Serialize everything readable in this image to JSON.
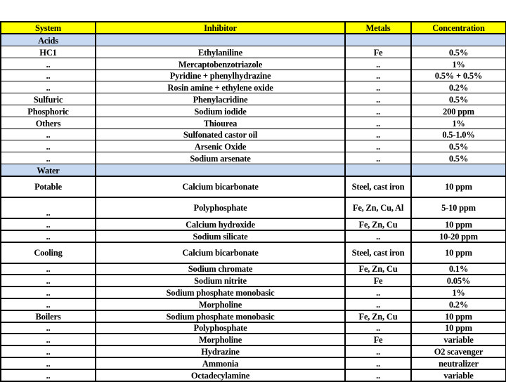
{
  "table": {
    "headers": {
      "system": "System",
      "inhibitor": "Inhibitor",
      "metals": "Metals",
      "concentration": "Concentration"
    },
    "sections": [
      {
        "label": "Acids",
        "rows": [
          {
            "system": "HC1",
            "inhibitor": "Ethylaniline",
            "metals": "Fe",
            "concentration": "0.5%"
          },
          {
            "system": "..",
            "inhibitor": "Mercaptobenzotriazole",
            "metals": "..",
            "concentration": "1%"
          },
          {
            "system": "..",
            "inhibitor": "Pyridine + phenylhydrazine",
            "metals": "..",
            "concentration": "0.5% + 0.5%"
          },
          {
            "system": "..",
            "inhibitor": "Rosin amine + ethylene oxide",
            "metals": "..",
            "concentration": "0.2%"
          },
          {
            "system": "Sulfuric",
            "inhibitor": "Phenylacridine",
            "metals": "..",
            "concentration": "0.5%"
          },
          {
            "system": "Phosphoric",
            "inhibitor": "Sodium iodide",
            "metals": "..",
            "concentration": "200 ppm"
          },
          {
            "system": "Others",
            "inhibitor": "Thiourea",
            "metals": "..",
            "concentration": "1%"
          },
          {
            "system": "..",
            "inhibitor": "Sulfonated castor oil",
            "metals": "..",
            "concentration": "0.5-1.0%"
          },
          {
            "system": "..",
            "inhibitor": "Arsenic Oxide",
            "metals": "..",
            "concentration": "0.5%"
          },
          {
            "system": "..",
            "inhibitor": "Sodium arsenate",
            "metals": "..",
            "concentration": "0.5%"
          }
        ]
      },
      {
        "label": "Water",
        "rows": [
          {
            "system": "Potable",
            "inhibitor": "Calcium bicarbonate",
            "metals": "Steel, cast iron",
            "concentration": "10 ppm"
          },
          {
            "system": "..",
            "inhibitor": "Polyphosphate",
            "metals": "Fe, Zn, Cu, Al",
            "concentration": "5-10 ppm"
          },
          {
            "system": "..",
            "inhibitor": "Calcium hydroxide",
            "metals": "Fe, Zn, Cu",
            "concentration": "10 ppm"
          },
          {
            "system": "..",
            "inhibitor": "Sodium silicate",
            "metals": "..",
            "concentration": "10-20 ppm"
          },
          {
            "system": "Cooling",
            "inhibitor": "Calcium bicarbonate",
            "metals": "Steel, cast iron",
            "concentration": "10 ppm"
          },
          {
            "system": "..",
            "inhibitor": "Sodium chromate",
            "metals": "Fe, Zn, Cu",
            "concentration": "0.1%"
          },
          {
            "system": "..",
            "inhibitor": "Sodium nitrite",
            "metals": "Fe",
            "concentration": "0.05%"
          },
          {
            "system": "..",
            "inhibitor": "Sodium phosphate monobasic",
            "metals": "..",
            "concentration": "1%"
          },
          {
            "system": "..",
            "inhibitor": "Morpholine",
            "metals": "..",
            "concentration": "0.2%"
          },
          {
            "system": "Boilers",
            "inhibitor": "Sodium phosphate monobasic",
            "metals": "Fe, Zn, Cu",
            "concentration": "10 ppm"
          },
          {
            "system": "..",
            "inhibitor": "Polyphosphate",
            "metals": "..",
            "concentration": "10 ppm"
          },
          {
            "system": "..",
            "inhibitor": "Morpholine",
            "metals": "Fe",
            "concentration": "variable"
          },
          {
            "system": "..",
            "inhibitor": "Hydrazine",
            "metals": "..",
            "concentration": "O2 scavenger"
          },
          {
            "system": "..",
            "inhibitor": "Ammonia",
            "metals": "..",
            "concentration": "neutralizer"
          },
          {
            "system": "..",
            "inhibitor": "Octadecylamine",
            "metals": "..",
            "concentration": "variable"
          }
        ]
      }
    ]
  },
  "colors": {
    "header_bg": "#ffff00",
    "section_bg": "#c6d9f0",
    "border": "#000000"
  }
}
